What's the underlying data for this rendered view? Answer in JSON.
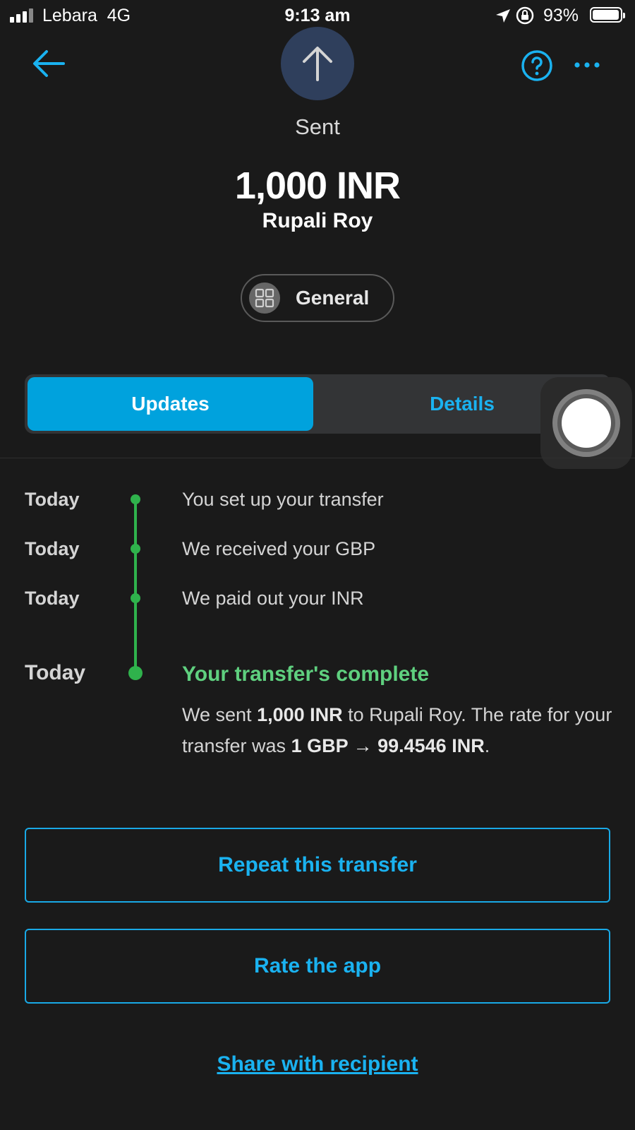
{
  "status_bar": {
    "carrier": "Lebara",
    "network": "4G",
    "time": "9:13 am",
    "battery": "93%",
    "battery_level": 0.93
  },
  "header": {
    "icon": "arrow-up-icon",
    "status": "Sent",
    "amount": "1,000 INR",
    "recipient": "Rupali Roy",
    "category": "General"
  },
  "tabs": [
    {
      "label": "Updates",
      "active": true
    },
    {
      "label": "Details",
      "active": false
    }
  ],
  "timeline": [
    {
      "date": "Today",
      "text": "You set up your transfer"
    },
    {
      "date": "Today",
      "text": "We received your GBP"
    },
    {
      "date": "Today",
      "text": "We paid out your INR"
    },
    {
      "date": "Today",
      "title": "Your transfer's complete",
      "desc_parts": [
        "We sent ",
        "1,000 INR",
        " to Rupali Roy. The rate for your transfer was ",
        "1 GBP → 99.4546 INR",
        "."
      ]
    }
  ],
  "actions": {
    "repeat": "Repeat this transfer",
    "rate": "Rate the app",
    "share": "Share with recipient"
  },
  "colors": {
    "background": "#1a1a1a",
    "accent": "#1ab2f0",
    "tab_active": "#00a2dd",
    "success": "#2fb24c",
    "success_text": "#5fd07f",
    "avatar": "#2f3f5c"
  }
}
